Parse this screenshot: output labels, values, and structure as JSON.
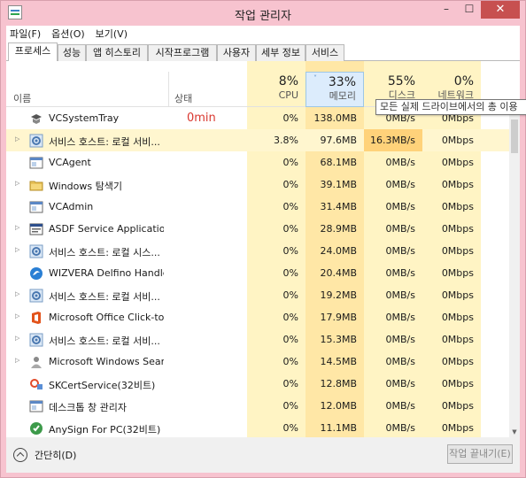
{
  "window": {
    "title": "작업 관리자",
    "controls": [
      "–",
      "☐",
      "✕"
    ]
  },
  "menu": [
    "파일(F)",
    "옵션(O)",
    "보기(V)"
  ],
  "tabs": [
    "프로세스",
    "성능",
    "앱 히스토리",
    "시작프로그램",
    "사용자",
    "세부 정보",
    "서비스"
  ],
  "active_tab": "프로세스",
  "columns": {
    "name": "이름",
    "status": "상태",
    "cpu": {
      "pct": "8%",
      "label": "CPU"
    },
    "memory": {
      "pct": "33%",
      "label": "메모리",
      "sorted": true,
      "sort_glyph": "˅"
    },
    "disk": {
      "pct": "55%",
      "label": "디스크"
    },
    "network": {
      "pct": "0%",
      "label": "네트워크"
    }
  },
  "tooltip": "모든 실제 드라이브에서의 총 이용",
  "processes": [
    {
      "name": "VCSystemTray",
      "status": "0min",
      "cpu": "0%",
      "memory": "138.0MB",
      "disk": "0MB/s",
      "network": "0Mbps",
      "expandable": false,
      "icon": "tray-app-icon",
      "highlight": false
    },
    {
      "name": "서비스 호스트: 로컬 서비...",
      "status": "",
      "cpu": "3.8%",
      "memory": "97.6MB",
      "disk": "16.3MB/s",
      "network": "0Mbps",
      "expandable": true,
      "icon": "service-gear-icon",
      "highlight": true
    },
    {
      "name": "VCAgent",
      "status": "",
      "cpu": "0%",
      "memory": "68.1MB",
      "disk": "0MB/s",
      "network": "0Mbps",
      "expandable": false,
      "icon": "window-app-icon",
      "highlight": false
    },
    {
      "name": "Windows 탐색기",
      "status": "",
      "cpu": "0%",
      "memory": "39.1MB",
      "disk": "0MB/s",
      "network": "0Mbps",
      "expandable": true,
      "icon": "folder-icon",
      "highlight": false
    },
    {
      "name": "VCAdmin",
      "status": "",
      "cpu": "0%",
      "memory": "31.4MB",
      "disk": "0MB/s",
      "network": "0Mbps",
      "expandable": false,
      "icon": "window-app-icon",
      "highlight": false
    },
    {
      "name": "ASDF Service Application",
      "status": "",
      "cpu": "0%",
      "memory": "28.9MB",
      "disk": "0MB/s",
      "network": "0Mbps",
      "expandable": true,
      "icon": "service-window-icon",
      "highlight": false
    },
    {
      "name": "서비스 호스트: 로컬 시스...",
      "status": "",
      "cpu": "0%",
      "memory": "24.0MB",
      "disk": "0MB/s",
      "network": "0Mbps",
      "expandable": true,
      "icon": "service-gear-icon",
      "highlight": false
    },
    {
      "name": "WIZVERA Delfino Handle...",
      "status": "",
      "cpu": "0%",
      "memory": "20.4MB",
      "disk": "0MB/s",
      "network": "0Mbps",
      "expandable": false,
      "icon": "delfino-icon",
      "highlight": false
    },
    {
      "name": "서비스 호스트: 로컬 서비...",
      "status": "",
      "cpu": "0%",
      "memory": "19.2MB",
      "disk": "0MB/s",
      "network": "0Mbps",
      "expandable": true,
      "icon": "service-gear-icon",
      "highlight": false
    },
    {
      "name": "Microsoft Office Click-to...",
      "status": "",
      "cpu": "0%",
      "memory": "17.9MB",
      "disk": "0MB/s",
      "network": "0Mbps",
      "expandable": true,
      "icon": "office-icon",
      "highlight": false
    },
    {
      "name": "서비스 호스트: 로컬 서비...",
      "status": "",
      "cpu": "0%",
      "memory": "15.3MB",
      "disk": "0MB/s",
      "network": "0Mbps",
      "expandable": true,
      "icon": "service-gear-icon",
      "highlight": false
    },
    {
      "name": "Microsoft Windows Sear...",
      "status": "",
      "cpu": "0%",
      "memory": "14.5MB",
      "disk": "0MB/s",
      "network": "0Mbps",
      "expandable": true,
      "icon": "search-user-icon",
      "highlight": false
    },
    {
      "name": "SKCertService(32비트)",
      "status": "",
      "cpu": "0%",
      "memory": "12.8MB",
      "disk": "0MB/s",
      "network": "0Mbps",
      "expandable": false,
      "icon": "cert-icon",
      "highlight": false
    },
    {
      "name": "데스크톱 창 관리자",
      "status": "",
      "cpu": "0%",
      "memory": "12.0MB",
      "disk": "0MB/s",
      "network": "0Mbps",
      "expandable": false,
      "icon": "window-app-icon",
      "highlight": false
    },
    {
      "name": "AnySign For PC(32비트)",
      "status": "",
      "cpu": "0%",
      "memory": "11.1MB",
      "disk": "0MB/s",
      "network": "0Mbps",
      "expandable": false,
      "icon": "anysign-icon",
      "highlight": false
    }
  ],
  "footer": {
    "collapse_label": "간단히(D)",
    "end_task_label": "작업 끝내기(E)"
  },
  "colors": {
    "window_frame": "#f7c3cf",
    "cpu_col": "#fff4c4",
    "memory_col": "#ffe7a6",
    "disk_col": "#fff4c4",
    "network_col": "#fff4c4",
    "disk_high": "#ffd27a",
    "status_red": "#d9372f"
  }
}
